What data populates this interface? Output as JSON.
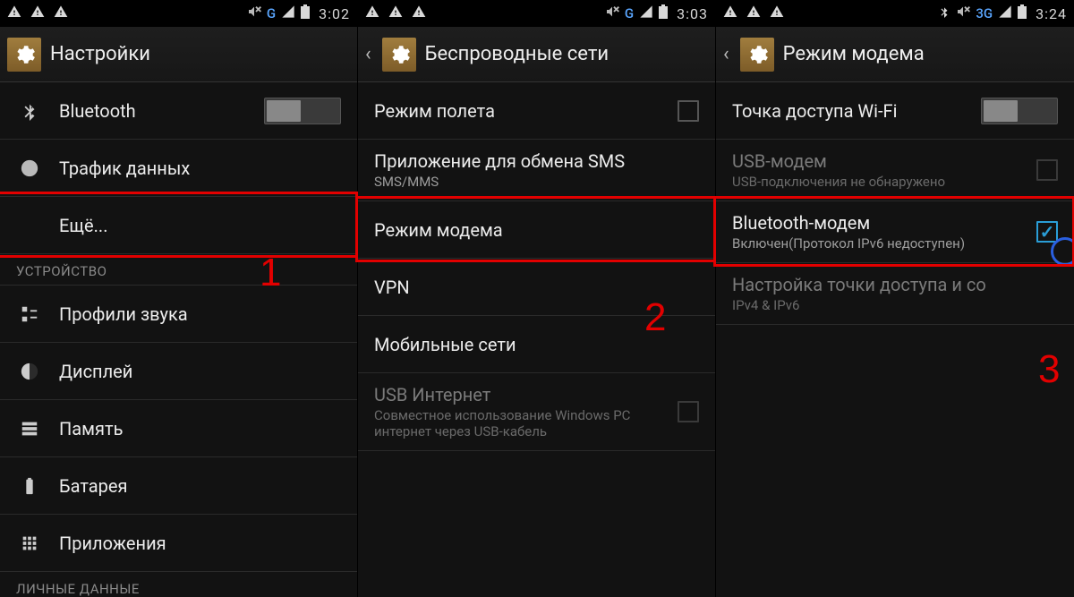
{
  "screens": [
    {
      "status": {
        "network": "G",
        "time": "3:02"
      },
      "title": "Настройки",
      "back": false,
      "sections": [
        {
          "type": "item",
          "icon": "bluetooth",
          "label": "Bluetooth",
          "control": "toggle"
        },
        {
          "type": "item",
          "icon": "data",
          "label": "Трафик данных"
        },
        {
          "type": "item",
          "indent": true,
          "label": "Ещё...",
          "highlight": true
        },
        {
          "type": "header",
          "label": "УСТРОЙСТВО"
        },
        {
          "type": "item",
          "icon": "sound",
          "label": "Профили звука"
        },
        {
          "type": "item",
          "icon": "display",
          "label": "Дисплей"
        },
        {
          "type": "item",
          "icon": "storage",
          "label": "Память"
        },
        {
          "type": "item",
          "icon": "battery",
          "label": "Батарея"
        },
        {
          "type": "item",
          "icon": "apps",
          "label": "Приложения"
        },
        {
          "type": "header",
          "label": "ЛИЧНЫЕ ДАННЫЕ"
        }
      ],
      "annotation": "1"
    },
    {
      "status": {
        "network": "G",
        "time": "3:03"
      },
      "title": "Беспроводные сети",
      "back": true,
      "sections": [
        {
          "type": "item",
          "label": "Режим полета",
          "control": "checkbox"
        },
        {
          "type": "item",
          "label": "Приложение для обмена SMS",
          "sub": "SMS/MMS"
        },
        {
          "type": "item",
          "label": "Режим модема",
          "highlight": true
        },
        {
          "type": "item",
          "label": "VPN"
        },
        {
          "type": "item",
          "label": "Мобильные сети"
        },
        {
          "type": "item",
          "label": "USB Интернет",
          "sub": "Совместное использование Windows PC интернет через USB-кабель",
          "control": "checkbox",
          "disabled": true
        }
      ],
      "annotation": "2"
    },
    {
      "status": {
        "network": "3G",
        "bt": true,
        "time": "3:24"
      },
      "title": "Режим модема",
      "back": true,
      "sections": [
        {
          "type": "item",
          "label": "Точка доступа Wi-Fi",
          "control": "toggle"
        },
        {
          "type": "item",
          "label": "USB-модем",
          "sub": "USB-подключения не обнаружено",
          "control": "checkbox",
          "disabled": true
        },
        {
          "type": "item",
          "label": "Bluetooth-модем",
          "sub": "Включен(Протокол IPv6 недоступен)",
          "control": "checkbox",
          "checked": true,
          "highlight": true
        },
        {
          "type": "item",
          "label": "Настройка точки доступа и со",
          "sub": "IPv4 & IPv6",
          "disabled": true
        }
      ],
      "annotation": "3",
      "circle": true
    }
  ]
}
